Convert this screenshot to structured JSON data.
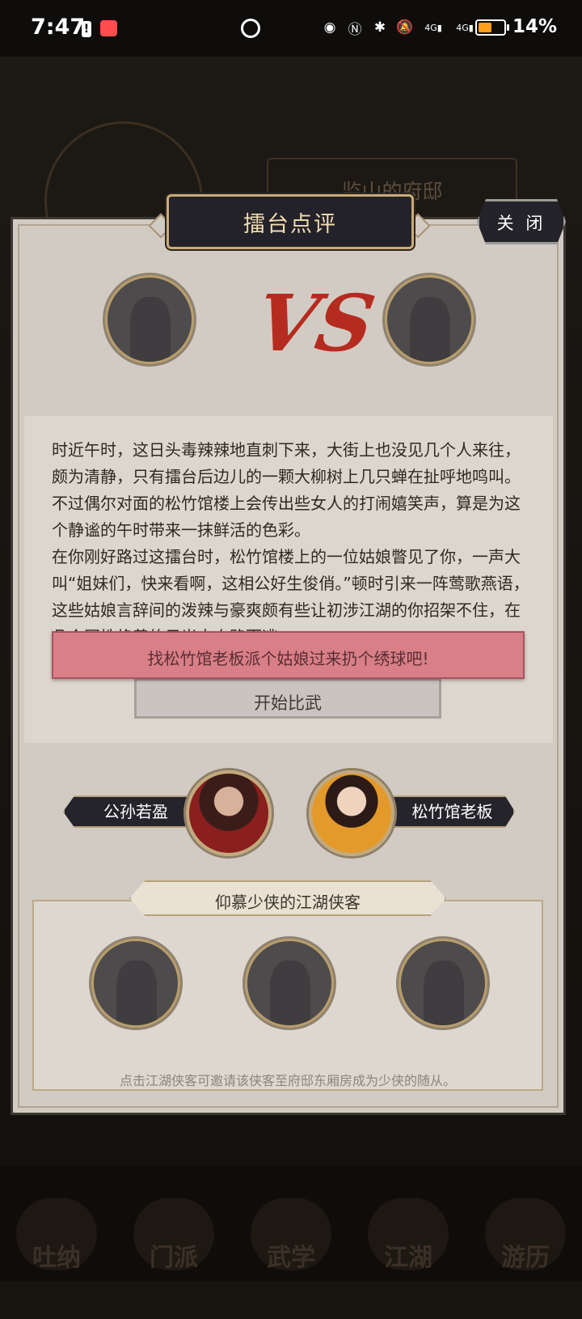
{
  "status_bar": {
    "time": "7:47",
    "battery_text": "14%",
    "battery_level": 0.14,
    "icons": [
      "alert-icon",
      "book-app-icon",
      "speedometer-icon",
      "eye-icon",
      "nfc-icon",
      "bluetooth-icon",
      "mute-bell-icon",
      "signal-4g-icon",
      "signal-4g-icon",
      "battery-icon"
    ],
    "signal_labels": [
      "4G",
      "4G"
    ]
  },
  "background": {
    "mansion_title": "监山的府邸",
    "nav_items": [
      "吐纳",
      "门派",
      "武学",
      "江湖",
      "游历"
    ]
  },
  "modal": {
    "title": "擂台点评",
    "close_label": "关 闭",
    "vs_label": "VS",
    "story_paragraphs": [
      "时近午时，这日头毒辣辣地直刺下来，大街上也没见几个人来往，颇为清静，只有擂台后边儿的一颗大柳树上几只蝉在扯呼地鸣叫。不过偶尔对面的松竹馆楼上会传出些女人的打闹嬉笑声，算是为这个静谧的午时带来一抹鲜活的色彩。",
      "在你刚好路过这擂台时，松竹馆楼上的一位姑娘瞥见了你，一声大叫“姐妹们，快来看啊，这相公好生俊俏。”顿时引来一阵莺歌燕语，这些姑娘言辞间的泼辣与豪爽颇有些让初涉江湖的你招架不住，在几个同性艳羡的目光中夺路而逃。"
    ],
    "banner_text": "找松竹馆老板派个姑娘过来扔个绣球吧!",
    "start_button": "开始比武",
    "left_character": "公孙若盈",
    "right_character": "松竹馆老板",
    "admirers_title": "仰慕少侠的江湖侠客",
    "admirers_hint": "点击江湖侠客可邀请该侠客至府邸东厢房成为少侠的随从。"
  },
  "colors": {
    "modal_bg": "#d2cbc3",
    "header_bg": "#23222a",
    "header_text": "#f2ddb0",
    "vs_red": "#b62b20",
    "banner_pink": "#d97f87",
    "gold_border": "#c9ac74"
  }
}
